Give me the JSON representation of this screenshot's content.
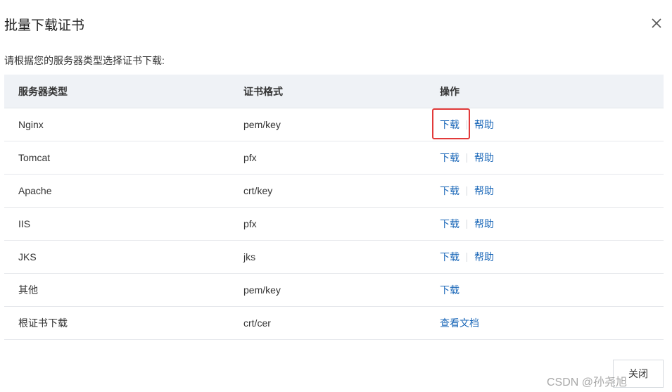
{
  "dialog": {
    "title": "批量下载证书",
    "instruction": "请根据您的服务器类型选择证书下载:",
    "close_button_label": "关闭"
  },
  "table": {
    "headers": [
      "服务器类型",
      "证书格式",
      "操作"
    ],
    "rows": [
      {
        "server": "Nginx",
        "format": "pem/key",
        "actions": [
          "下载",
          "帮助"
        ]
      },
      {
        "server": "Tomcat",
        "format": "pfx",
        "actions": [
          "下载",
          "帮助"
        ]
      },
      {
        "server": "Apache",
        "format": "crt/key",
        "actions": [
          "下载",
          "帮助"
        ]
      },
      {
        "server": "IIS",
        "format": "pfx",
        "actions": [
          "下载",
          "帮助"
        ]
      },
      {
        "server": "JKS",
        "format": "jks",
        "actions": [
          "下载",
          "帮助"
        ]
      },
      {
        "server": "其他",
        "format": "pem/key",
        "actions": [
          "下载"
        ]
      },
      {
        "server": "根证书下载",
        "format": "crt/cer",
        "actions": [
          "查看文档"
        ]
      }
    ]
  },
  "watermark": "CSDN @孙尧旭",
  "colors": {
    "link": "#1a67b8",
    "header_bg": "#eff2f6",
    "highlight": "#e23a3a"
  },
  "icons": {
    "close": "close-icon"
  }
}
